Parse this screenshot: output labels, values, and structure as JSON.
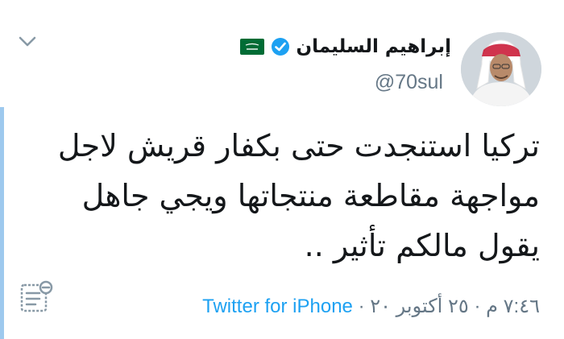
{
  "author": {
    "name": "إبراهيم السليمان",
    "handle": "@70sul",
    "verified": true,
    "flag": "saudi-arabia-flag"
  },
  "tweet": {
    "lines": [
      "تركيا استنجدت حتى بكفار قريش لاجل",
      "مواجهة مقاطعة منتجاتها ويجي جاهل",
      "يقول مالكم تأثير .."
    ]
  },
  "meta": {
    "time_date": "٧:٤٦ م · ٢٥ أكتوبر ٢٠",
    "separator": "·",
    "source": "Twitter for iPhone"
  },
  "colors": {
    "accent": "#1da1f2",
    "secondary_text": "#657786",
    "thread_line": "#9ec9ee"
  }
}
